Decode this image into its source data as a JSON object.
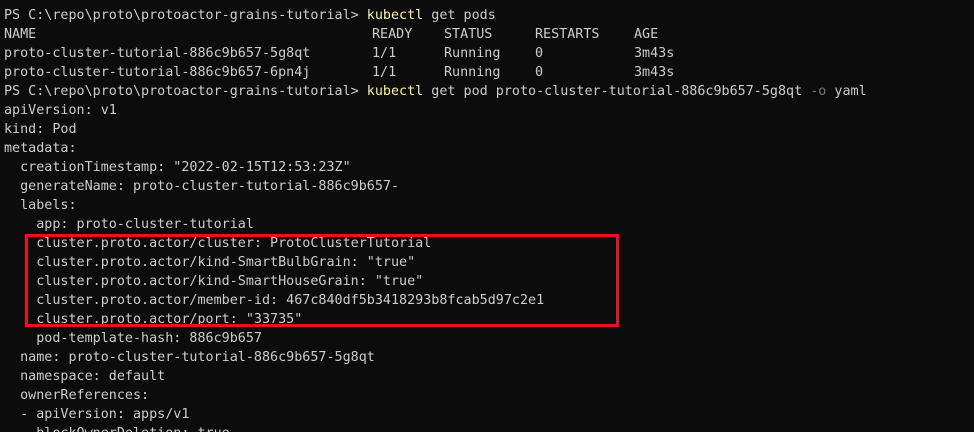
{
  "prompt1": {
    "ps": "PS C:\\repo\\proto\\protoactor-grains-tutorial> ",
    "cmd": "kubectl",
    "args": " get pods"
  },
  "pods_header": {
    "name": "NAME",
    "ready": "READY",
    "status": "STATUS",
    "restarts": "RESTARTS",
    "age": "AGE"
  },
  "pods": [
    {
      "name": "proto-cluster-tutorial-886c9b657-5g8qt",
      "ready": "1/1",
      "status": "Running",
      "restarts": "0",
      "age": "3m43s"
    },
    {
      "name": "proto-cluster-tutorial-886c9b657-6pn4j",
      "ready": "1/1",
      "status": "Running",
      "restarts": "0",
      "age": "3m43s"
    }
  ],
  "prompt2": {
    "ps": "PS C:\\repo\\proto\\protoactor-grains-tutorial> ",
    "cmd": "kubectl",
    "args": " get pod proto-cluster-tutorial-886c9b657-5g8qt ",
    "flag": "-o",
    "format": " yaml"
  },
  "yaml": {
    "l1": "apiVersion: v1",
    "l2": "kind: Pod",
    "l3": "metadata:",
    "l4": "  creationTimestamp: \"2022-02-15T12:53:23Z\"",
    "l5": "  generateName: proto-cluster-tutorial-886c9b657-",
    "l6": "  labels:",
    "l7": "    app: proto-cluster-tutorial",
    "l8": "    cluster.proto.actor/cluster: ProtoClusterTutorial",
    "l9": "    cluster.proto.actor/kind-SmartBulbGrain: \"true\"",
    "l10": "    cluster.proto.actor/kind-SmartHouseGrain: \"true\"",
    "l11": "    cluster.proto.actor/member-id: 467c840df5b3418293b8fcab5d97c2e1",
    "l12": "    cluster.proto.actor/port: \"33735\"",
    "l13": "    pod-template-hash: 886c9b657",
    "l14": "  name: proto-cluster-tutorial-886c9b657-5g8qt",
    "l15": "  namespace: default",
    "l16": "  ownerReferences:",
    "l17": "  - apiVersion: apps/v1",
    "l18": "    blockOwnerDeletion: true"
  },
  "colors": {
    "background": "#0c0c0c",
    "text": "#cccccc",
    "command": "#f9f1a5",
    "flag": "#767676",
    "highlight_border": "#e81123"
  }
}
